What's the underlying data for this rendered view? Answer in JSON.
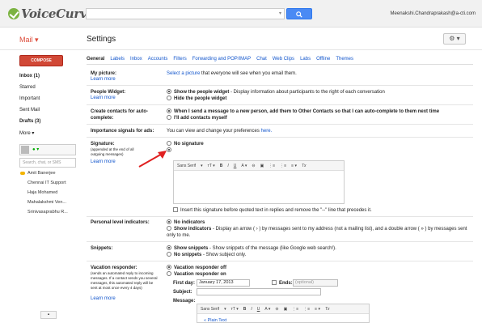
{
  "header": {
    "logo_text": "VoiceCurve",
    "search_placeholder": "",
    "search_dropdown": "▾",
    "search_button_icon": "search-icon",
    "user_email": "Meenakshi.Chandraprakash@a-cti.com"
  },
  "mail_header": {
    "mail_label": "Mail ▾",
    "page_title": "Settings",
    "gear_label": "⚙ ▾"
  },
  "sidebar": {
    "compose_label": "COMPOSE",
    "items": [
      {
        "label": "Inbox (1)",
        "bold": true
      },
      {
        "label": "Starred",
        "bold": false
      },
      {
        "label": "Important",
        "bold": false
      },
      {
        "label": "Sent Mail",
        "bold": false
      },
      {
        "label": "Drafts (3)",
        "bold": true
      },
      {
        "label": "More ▾",
        "bold": false
      }
    ],
    "chat_search_placeholder": "Search, chat, or SMS",
    "chat_status": "● ▾",
    "contacts": [
      "Amit Banerjee",
      "Chennai IT Support",
      "Haja Mohamed",
      "Mahalakshmi Ven...",
      "Srinivasaprabhu R..."
    ]
  },
  "tabs": [
    "General",
    "Labels",
    "Inbox",
    "Accounts",
    "Filters",
    "Forwarding and POP/IMAP",
    "Chat",
    "Web Clips",
    "Labs",
    "Offline",
    "Themes"
  ],
  "active_tab": "General",
  "settings": {
    "picture": {
      "label": "My picture:",
      "learn_more": "Learn more",
      "select_link": "Select a picture",
      "text": " that everyone will see when you email them."
    },
    "people_widget": {
      "label": "People Widget:",
      "learn_more": "Learn more",
      "opt1_bold": "Show the people widget",
      "opt1_rest": " - Display information about participants to the right of each conversation",
      "opt2_bold": "Hide the people widget"
    },
    "contacts": {
      "label": "Create contacts for auto-complete:",
      "opt1_bold": "When I send a message to a new person, add them to Other Contacts so that I can auto-complete to them next time",
      "opt2_bold": "I'll add contacts myself"
    },
    "importance": {
      "label": "Importance signals for ads:",
      "text": "You can view and change your preferences ",
      "link": "here."
    },
    "signature": {
      "label": "Signature:",
      "sub": "(appended at the end of all outgoing messages)",
      "learn_more": "Learn more",
      "opt1_bold": "No signature",
      "toolbar_font": "Sans Serif",
      "toolbar_items": [
        "▾",
        "тT ▾",
        "B",
        "I",
        "U",
        "A ▾",
        "⊖",
        "🔗",
        "▣",
        "⋮≡",
        "⋮≡",
        "≡ ▾",
        "Tx"
      ],
      "insert_text": "Insert this signature before quoted text in replies and remove the \"--\" line that precedes it."
    },
    "level_indicators": {
      "label": "Personal level indicators:",
      "opt1_bold": "No indicators",
      "opt2_bold": "Show indicators",
      "opt2_rest": " - Display an arrow ( › ) by messages sent to my address (not a mailing list), and a double arrow ( » ) by messages sent only to me."
    },
    "snippets": {
      "label": "Snippets:",
      "opt1_bold": "Show snippets",
      "opt1_rest": " - Show snippets of the message (like Google web search!).",
      "opt2_bold": "No snippets",
      "opt2_rest": " - Show subject only."
    },
    "vacation": {
      "label": "Vacation responder:",
      "sub": "(sends an automated reply to incoming messages. If a contact sends you several messages, this automated reply will be sent at most once every 4 days)",
      "learn_more": "Learn more",
      "opt1_bold": "Vacation responder off",
      "opt2_bold": "Vacation responder on",
      "first_day_label": "First day:",
      "first_day_value": "January 17, 2013",
      "ends_label": "Ends:",
      "ends_placeholder": "(optional)",
      "subject_label": "Subject:",
      "message_label": "Message:",
      "toolbar_font": "Sans Serif",
      "plain_text": "« Plain Text"
    }
  },
  "colors": {
    "mail_red": "#dd4b39",
    "compose_red": "#d14836",
    "link_blue": "#1155cc",
    "search_blue": "#4a8af4",
    "arrow_red": "#e02020"
  }
}
